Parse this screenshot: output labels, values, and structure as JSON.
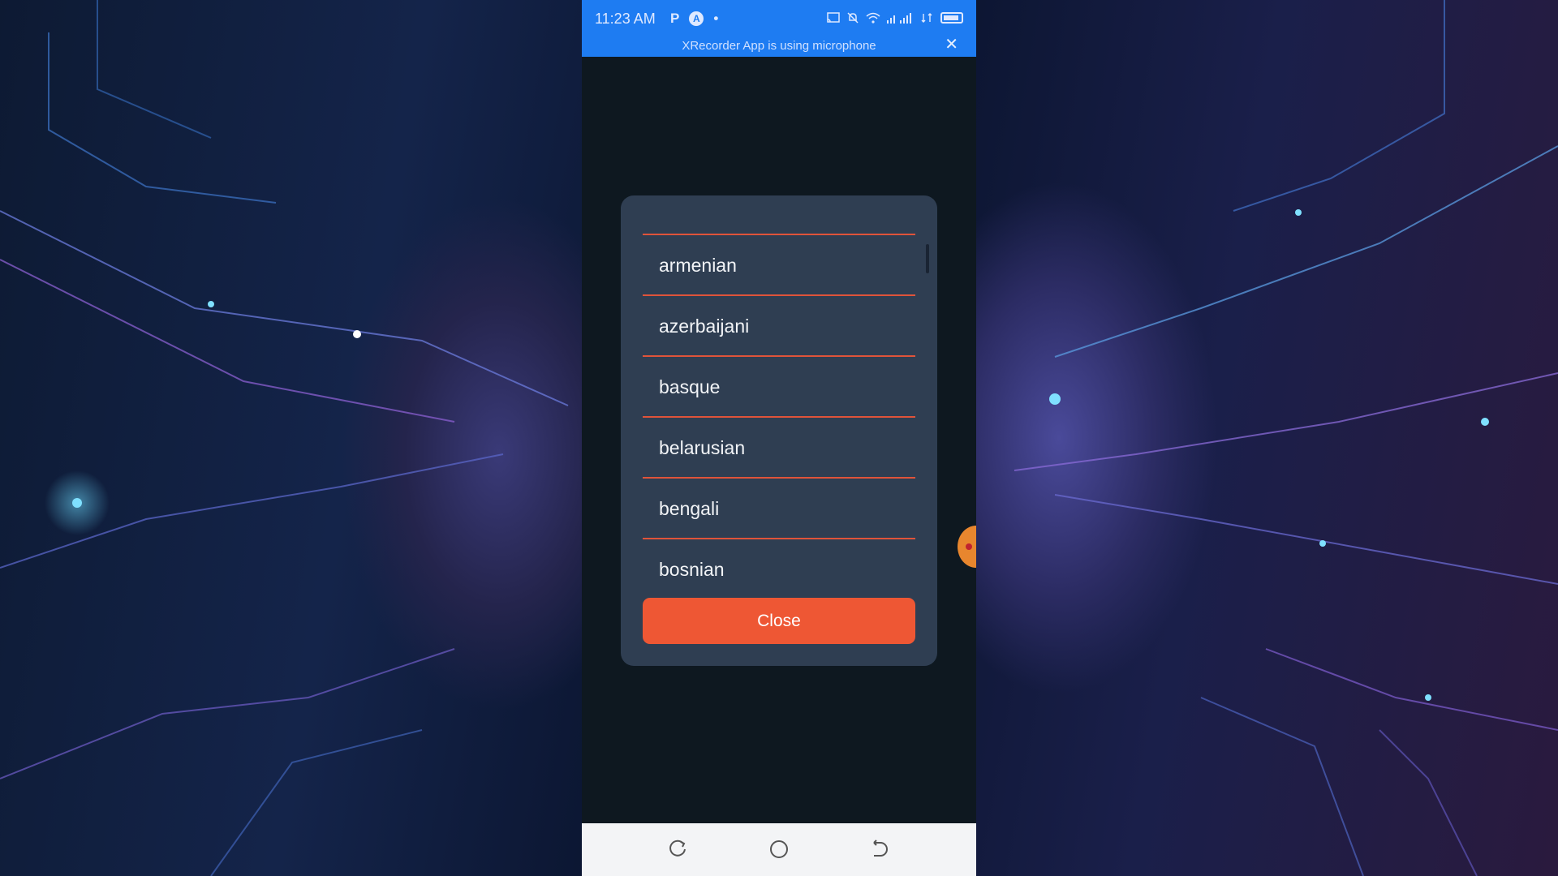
{
  "status_bar": {
    "time": "11:23 AM",
    "left_icons": [
      "P",
      "A",
      "•"
    ],
    "right_icons": [
      "cast-icon",
      "mute-icon",
      "wifi-icon",
      "signal-icon",
      "data-icon",
      "battery-icon"
    ]
  },
  "recording_notice": {
    "text": "XRecorder App is using microphone",
    "close_glyph": "✕"
  },
  "dialog": {
    "items": [
      {
        "label": "armenian"
      },
      {
        "label": "azerbaijani"
      },
      {
        "label": "basque"
      },
      {
        "label": "belarusian"
      },
      {
        "label": "bengali"
      },
      {
        "label": "bosnian"
      }
    ],
    "close_label": "Close"
  },
  "nav_bar": {
    "buttons": [
      "recent-apps-icon",
      "home-icon",
      "back-icon"
    ]
  },
  "colors": {
    "status_bar": "#1e7cf2",
    "dialog_bg": "#2f3e52",
    "divider": "#e0533a",
    "close_button": "#ee5734",
    "app_bg": "#0e1820"
  }
}
